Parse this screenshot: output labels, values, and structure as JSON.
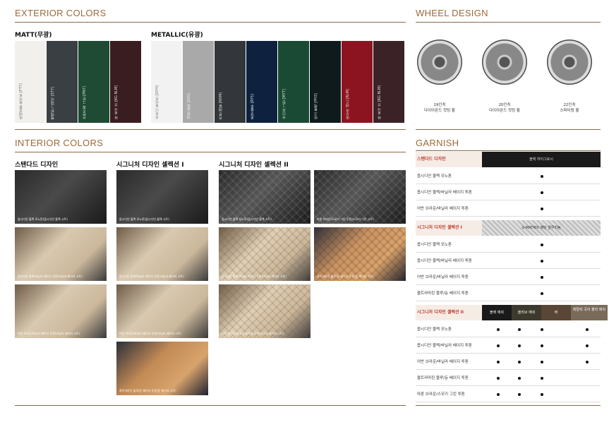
{
  "exterior": {
    "title": "EXTERIOR COLORS",
    "matt_label": "MATT(무광)",
    "metallic_label": "METALLIC(유광)",
    "matt": [
      {
        "name": "마테호른 화이트 [FT7]",
        "color": "#f1f0ec"
      },
      {
        "name": "펠레린 그레이 [ST7]",
        "color": "#3a3f44"
      },
      {
        "name": "브런즈윅 그린 [PN7]",
        "color": "#1f4a33"
      },
      {
        "name": "바 로샤 브 [KG BLM]",
        "color": "#3a1d20"
      }
    ],
    "metallic": [
      {
        "name": "우유니 화이트 [UYH]",
        "color": "#f2f2f2"
      },
      {
        "name": "세빌 실버 [SSS]",
        "color": "#a9a9a9"
      },
      {
        "name": "카본 메탈 [NSM]",
        "color": "#33373b"
      },
      {
        "name": "로얄 블루 [RY5]",
        "color": "#0e2240"
      },
      {
        "name": "카디프 그린 [M7T]",
        "color": "#1a4a34"
      },
      {
        "name": "비크 블랙 [PH3]",
        "color": "#0f1a1c"
      },
      {
        "name": "마우라 레드 [RLM]",
        "color": "#8c1420"
      },
      {
        "name": "바 로샤 브 [KG BLM]",
        "color": "#3b2226"
      }
    ]
  },
  "wheels": {
    "title": "WHEEL DESIGN",
    "items": [
      {
        "size": "19인치",
        "name": "다이아몬드 컷팅 휠"
      },
      {
        "size": "20인치",
        "name": "다이아몬드 컷팅 휠"
      },
      {
        "size": "22인치",
        "name": "스퍼터링 휠"
      }
    ]
  },
  "interior": {
    "title": "INTERIOR COLORS",
    "columns": [
      {
        "heading": "스탠다드 디자인",
        "items": [
          {
            "caption": "옵시디언 블랙 모노톤(옵시디언 블랙 시트)",
            "tone": "dark"
          },
          {
            "caption": "옵시디언 블랙/바닐라 베이지 투톤(바닐라 베이지 시트)",
            "tone": "beige"
          },
          {
            "caption": "어반 브라운/바닐라 베이지 투톤(바닐라 베이지 시트)",
            "tone": "beige"
          }
        ]
      },
      {
        "heading": "시그니처 디자인 셀렉션 I",
        "items": [
          {
            "caption": "옵시디언 블랙 모노톤(옵시디언 블랙 시트)",
            "tone": "dark"
          },
          {
            "caption": "옵시디언 블랙/바닐라 베이지 투톤(바닐라 베이지 시트)",
            "tone": "beige"
          },
          {
            "caption": "어반 브라운/바닐라 베이지 투톤(바닐라 베이지 시트)",
            "tone": "beige"
          },
          {
            "caption": "울트라마린 블루/듄 베이지 투톤(듄 베이지 시트)",
            "tone": "tan"
          }
        ]
      },
      {
        "heading": "시그니처 디자인 셀렉션 II",
        "items": [
          {
            "caption": "옵시디언 블랙 모노톤(옵시디언 블랙 시트)",
            "tone": "quilt-dark"
          },
          {
            "caption": "옵시디언 블랙/바닐라 베이지 투톤(바닐라 베이지 시트)",
            "tone": "quilt-beige"
          },
          {
            "caption": "어반 브라운/바닐라 베이지 투톤(바닐라 베이지 시트)",
            "tone": "quilt-beige"
          }
        ]
      },
      {
        "heading": "",
        "items": [
          {
            "caption": "마룬 브라운/스모키 그린 투톤(스모키 그린 시트)",
            "tone": "quilt-dark"
          },
          {
            "caption": "울트라마린 블루/듄 베이지 투톤(듄 베이지 시트)",
            "tone": "quilt-tan"
          }
        ]
      }
    ]
  },
  "garnish": {
    "title": "GARNISH",
    "groups": [
      {
        "label": "스탠다드 디자인",
        "tiles": [
          "블랙 하이그로시"
        ],
        "rows": [
          "옵시디언 블랙 모노톤",
          "옵시디언 블랙/바닐라 베이지 투톤",
          "어반 브라운/바닐라 베이지 투톤"
        ]
      },
      {
        "label": "시그니처 디자인 셀렉션 I",
        "tiles": [
          "G-MATRIX 패턴 알루미늄"
        ],
        "rows": [
          "옵시디언 블랙 모노톤",
          "옵시디언 블랙/바닐라 베이지 투톤",
          "어반 브라운/바닐라 베이지 투톤",
          "울트라마린 블루/듄 베이지 투톤"
        ]
      },
      {
        "label": "시그니처 디자인 셀렉션 II",
        "tiles": [
          "블랙 애쉬",
          "올리브 애쉬",
          "버 ",
          "레탈릭 곡이 플리 애쉬"
        ],
        "rows": [
          "옵시디언 블랙 모노톤",
          "옵시디언 블랙/바닐라 베이지 투톤",
          "어반 브라운/바닐라 베이지 투톤",
          "울트라마린 블루/듄 베이지 투톤",
          "마룬 브라운/스모키 그린 투톤"
        ]
      }
    ]
  }
}
